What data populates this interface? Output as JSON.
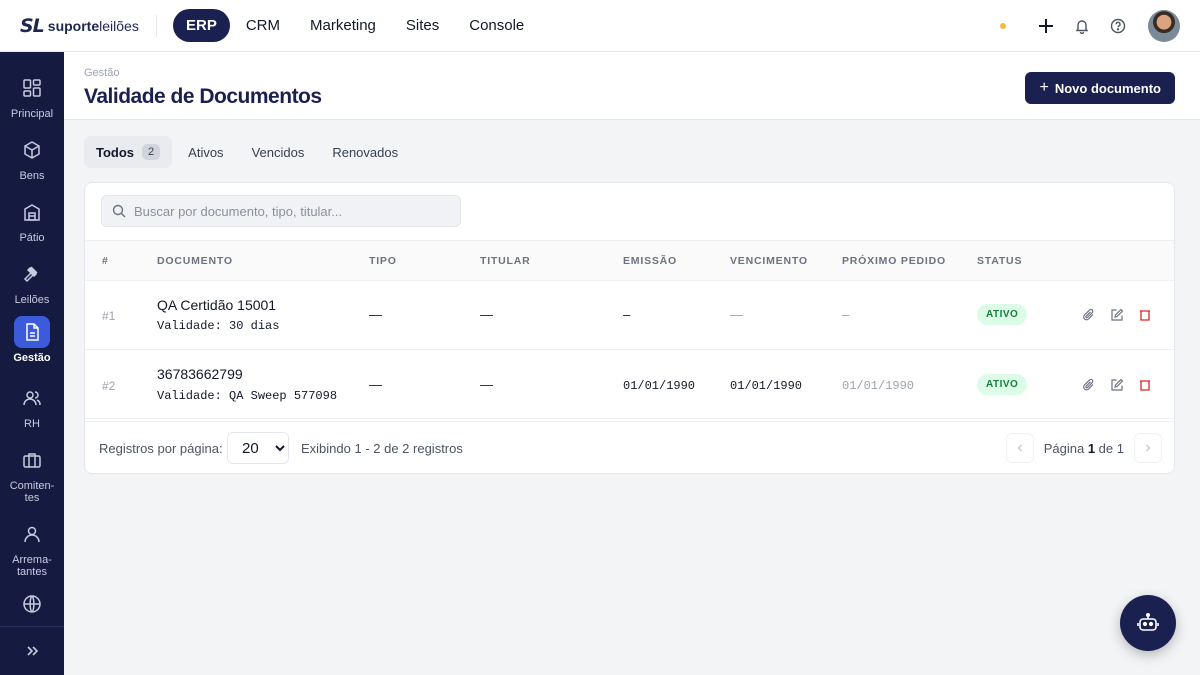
{
  "brand": {
    "mark": "SL",
    "name_bold": "suporte",
    "name_rest": "leilões"
  },
  "topnav": [
    {
      "label": "ERP",
      "active": true
    },
    {
      "label": "CRM",
      "active": false
    },
    {
      "label": "Marketing",
      "active": false
    },
    {
      "label": "Sites",
      "active": false
    },
    {
      "label": "Console",
      "active": false
    }
  ],
  "topbar_icons": [
    "status-dot",
    "plus-icon",
    "bell-icon",
    "help-icon",
    "avatar"
  ],
  "sidebar": [
    {
      "label": "Principal",
      "icon": "grid-icon"
    },
    {
      "label": "Bens",
      "icon": "box-icon"
    },
    {
      "label": "Pátio",
      "icon": "warehouse-icon"
    },
    {
      "label": "Leilões",
      "icon": "gavel-icon"
    },
    {
      "label": "Gestão",
      "icon": "document-icon",
      "active": true
    },
    {
      "label": "RH",
      "icon": "users-icon"
    },
    {
      "label": "Comiten-\ntes",
      "icon": "briefcase-icon"
    },
    {
      "label": "Arrema-\ntantes",
      "icon": "user-icon"
    },
    {
      "label": "",
      "icon": "globe-icon"
    }
  ],
  "page": {
    "breadcrumb": "Gestão",
    "title": "Validade de Documentos",
    "new_button": "Novo documento"
  },
  "tabs": [
    {
      "label": "Todos",
      "count": "2",
      "active": true
    },
    {
      "label": "Ativos"
    },
    {
      "label": "Vencidos"
    },
    {
      "label": "Renovados"
    }
  ],
  "search": {
    "placeholder": "Buscar por documento, tipo, titular..."
  },
  "table": {
    "headers": [
      "#",
      "DOCUMENTO",
      "TIPO",
      "TITULAR",
      "EMISSÃO",
      "VENCIMENTO",
      "PRÓXIMO PEDIDO",
      "STATUS"
    ],
    "rows": [
      {
        "num": "#1",
        "title": "QA Certidão 15001",
        "sub": "Validade: 30 dias",
        "tipo": "—",
        "titular": "—",
        "emissao": "–",
        "vencimento": "—",
        "proximo": "–",
        "status": "ATIVO"
      },
      {
        "num": "#2",
        "title": "36783662799",
        "sub": "Validade: QA Sweep 577098",
        "tipo": "—",
        "titular": "—",
        "emissao": "01/01/1990",
        "vencimento": "01/01/1990",
        "proximo": "01/01/1990",
        "status": "ATIVO"
      }
    ]
  },
  "footer": {
    "per_page_label": "Registros por página:",
    "per_page_value": "20",
    "info": "Exibindo 1 - 2 de 2 registros",
    "page_prefix": "Página",
    "page_current": "1",
    "page_mid": "de",
    "page_total": "1"
  },
  "colors": {
    "navy": "#1a2150",
    "sidebar": "#151b40",
    "active_blue": "#3b5bdb",
    "status_green": "#15803d",
    "danger": "#dc2626"
  }
}
